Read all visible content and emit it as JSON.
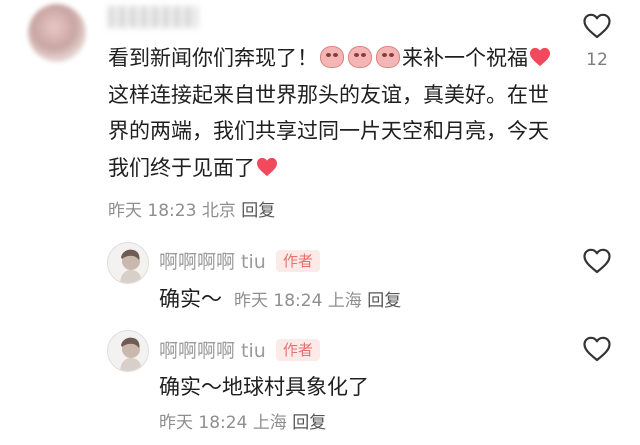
{
  "comment": {
    "text_part1": "看到新闻你们奔现了！",
    "text_part2": "来补一个祝福",
    "text_part3": "这样连接起来自世界那头的友谊，真美好。在世界的两端，我们共享过同一片天空和月亮，今天我们终于见面了",
    "time": "昨天 18:23",
    "location": "北京",
    "reply_label": "回复",
    "like_count": "12",
    "emojis": [
      "pig-emoji",
      "pig-emoji",
      "pig-emoji"
    ],
    "heart_color": "#f24a5c"
  },
  "replies": [
    {
      "username": "啊啊啊啊 tiu",
      "badge": "作者",
      "text": "确实～",
      "time": "昨天 18:24",
      "location": "上海",
      "reply_label": "回复"
    },
    {
      "username": "啊啊啊啊 tiu",
      "badge": "作者",
      "text": "确实～地球村具象化了",
      "time": "昨天 18:24",
      "location": "上海",
      "reply_label": "回复"
    }
  ],
  "colors": {
    "badge_text": "#e3736b",
    "badge_bg": "#fbeae8",
    "meta": "#8e8e8e"
  }
}
